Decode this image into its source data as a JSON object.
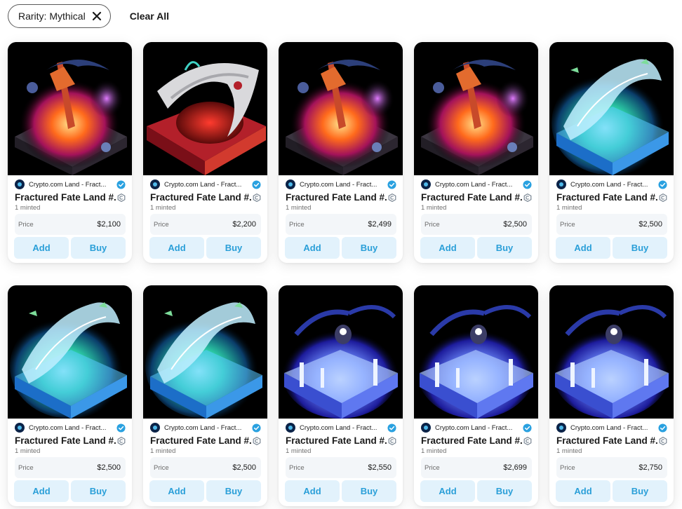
{
  "filters": {
    "chip_label": "Rarity: Mythical",
    "clear_all_label": "Clear All"
  },
  "cards": [
    {
      "creator": "Crypto.com Land - Fract...",
      "title": "Fractured Fate Land #...",
      "minted": "1 minted",
      "price_label": "Price",
      "price": "$2,100",
      "add_label": "Add",
      "buy_label": "Buy",
      "art": "fire-land"
    },
    {
      "creator": "Crypto.com Land - Fract...",
      "title": "Fractured Fate Land #...",
      "minted": "1 minted",
      "price_label": "Price",
      "price": "$2,200",
      "add_label": "Add",
      "buy_label": "Buy",
      "art": "dragon-land"
    },
    {
      "creator": "Crypto.com Land - Fract...",
      "title": "Fractured Fate Land #...",
      "minted": "1 minted",
      "price_label": "Price",
      "price": "$2,499",
      "add_label": "Add",
      "buy_label": "Buy",
      "art": "fire-land"
    },
    {
      "creator": "Crypto.com Land - Fract...",
      "title": "Fractured Fate Land #...",
      "minted": "1 minted",
      "price_label": "Price",
      "price": "$2,500",
      "add_label": "Add",
      "buy_label": "Buy",
      "art": "fire-land"
    },
    {
      "creator": "Crypto.com Land - Fract...",
      "title": "Fractured Fate Land #...",
      "minted": "1 minted",
      "price_label": "Price",
      "price": "$2,500",
      "add_label": "Add",
      "buy_label": "Buy",
      "art": "ice-land"
    },
    {
      "creator": "Crypto.com Land - Fract...",
      "title": "Fractured Fate Land #...",
      "minted": "1 minted",
      "price_label": "Price",
      "price": "$2,500",
      "add_label": "Add",
      "buy_label": "Buy",
      "art": "ice-land"
    },
    {
      "creator": "Crypto.com Land - Fract...",
      "title": "Fractured Fate Land #...",
      "minted": "1 minted",
      "price_label": "Price",
      "price": "$2,500",
      "add_label": "Add",
      "buy_label": "Buy",
      "art": "ice-land"
    },
    {
      "creator": "Crypto.com Land - Fract...",
      "title": "Fractured Fate Land #...",
      "minted": "1 minted",
      "price_label": "Price",
      "price": "$2,550",
      "add_label": "Add",
      "buy_label": "Buy",
      "art": "crystal-land"
    },
    {
      "creator": "Crypto.com Land - Fract...",
      "title": "Fractured Fate Land #...",
      "minted": "1 minted",
      "price_label": "Price",
      "price": "$2,699",
      "add_label": "Add",
      "buy_label": "Buy",
      "art": "crystal-land"
    },
    {
      "creator": "Crypto.com Land - Fract...",
      "title": "Fractured Fate Land #...",
      "minted": "1 minted",
      "price_label": "Price",
      "price": "$2,750",
      "add_label": "Add",
      "buy_label": "Buy",
      "art": "crystal-land"
    }
  ],
  "colors": {
    "accent": "#2a9fd8",
    "button_bg": "#e2f2fc",
    "verified": "#2aa1e0"
  }
}
